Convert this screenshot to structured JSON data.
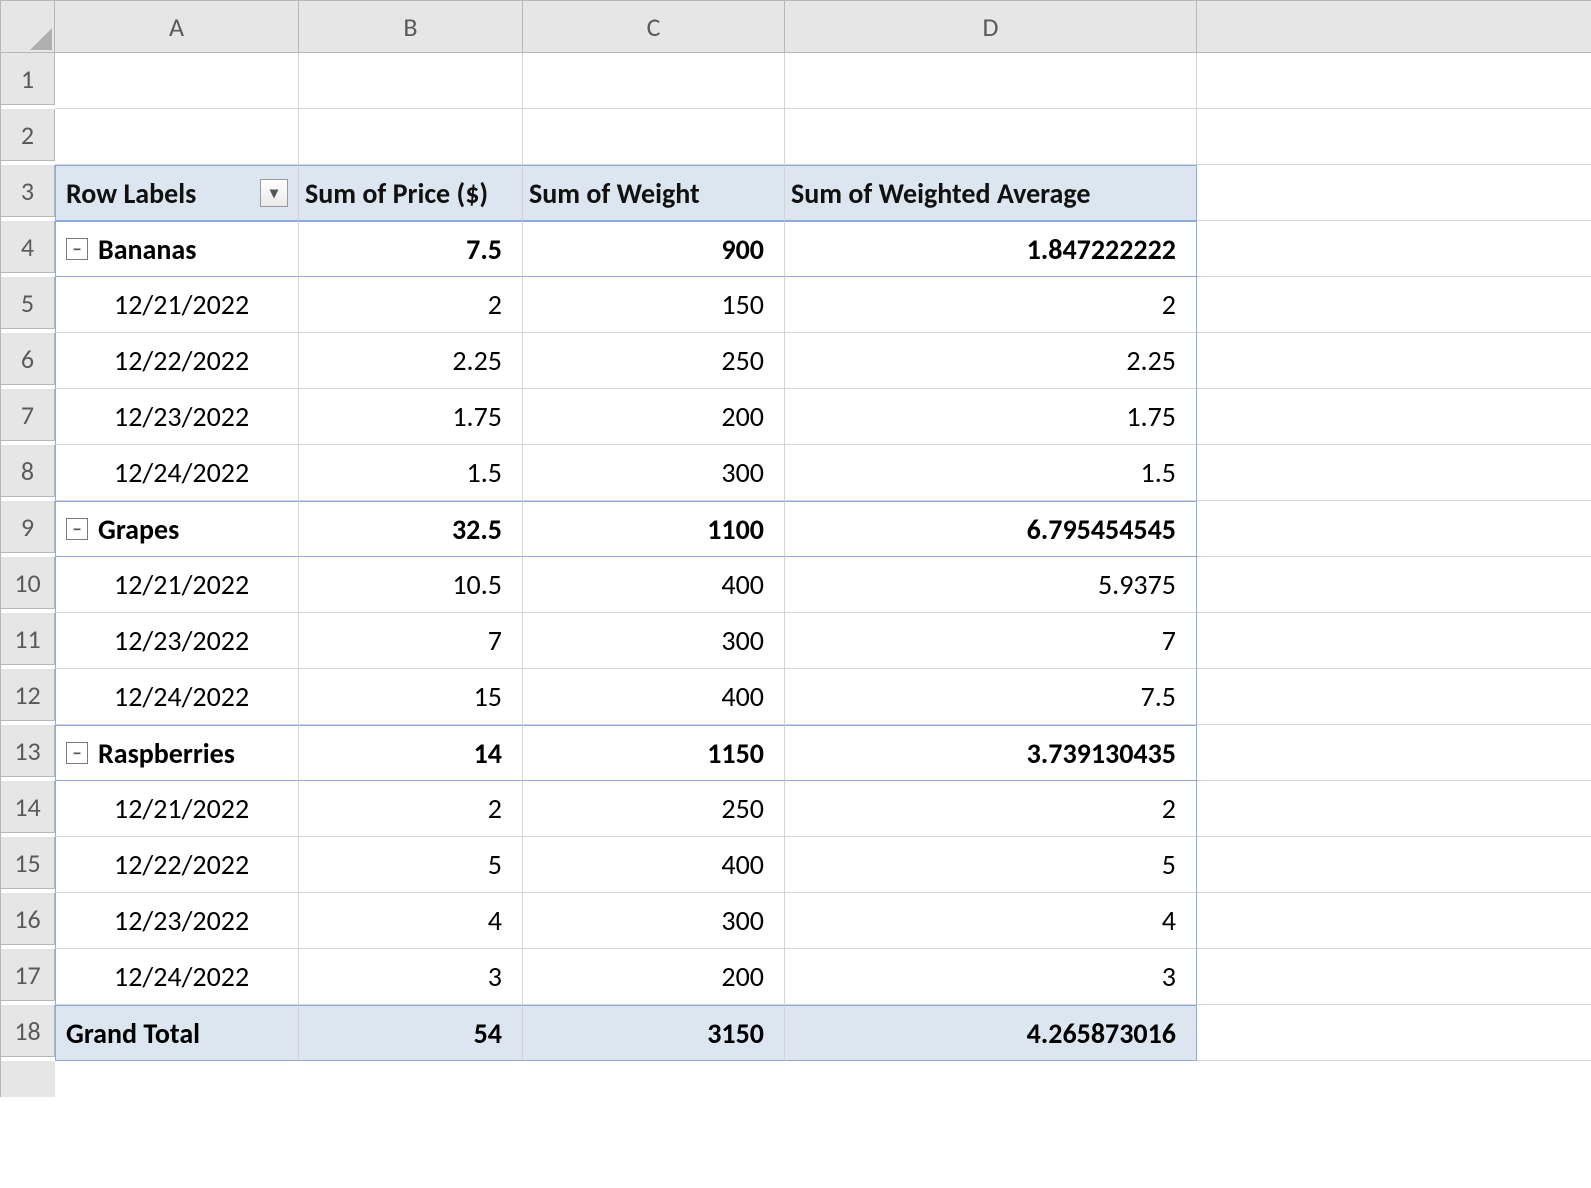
{
  "columns": [
    "A",
    "B",
    "C",
    "D"
  ],
  "rows": [
    "1",
    "2",
    "3",
    "4",
    "5",
    "6",
    "7",
    "8",
    "9",
    "10",
    "11",
    "12",
    "13",
    "14",
    "15",
    "16",
    "17",
    "18"
  ],
  "pivot": {
    "headers": {
      "row_labels": "Row Labels",
      "price": "Sum of Price ($)",
      "weight": "Sum of Weight",
      "weighted": "Sum of Weighted Average"
    },
    "groups": [
      {
        "name": "Bananas",
        "price": "7.5",
        "weight": "900",
        "weighted": "1.847222222",
        "rows": [
          {
            "label": "12/21/2022",
            "price": "2",
            "weight": "150",
            "weighted": "2"
          },
          {
            "label": "12/22/2022",
            "price": "2.25",
            "weight": "250",
            "weighted": "2.25"
          },
          {
            "label": "12/23/2022",
            "price": "1.75",
            "weight": "200",
            "weighted": "1.75"
          },
          {
            "label": "12/24/2022",
            "price": "1.5",
            "weight": "300",
            "weighted": "1.5"
          }
        ]
      },
      {
        "name": "Grapes",
        "price": "32.5",
        "weight": "1100",
        "weighted": "6.795454545",
        "rows": [
          {
            "label": "12/21/2022",
            "price": "10.5",
            "weight": "400",
            "weighted": "5.9375"
          },
          {
            "label": "12/23/2022",
            "price": "7",
            "weight": "300",
            "weighted": "7"
          },
          {
            "label": "12/24/2022",
            "price": "15",
            "weight": "400",
            "weighted": "7.5"
          }
        ]
      },
      {
        "name": "Raspberries",
        "price": "14",
        "weight": "1150",
        "weighted": "3.739130435",
        "rows": [
          {
            "label": "12/21/2022",
            "price": "2",
            "weight": "250",
            "weighted": "2"
          },
          {
            "label": "12/22/2022",
            "price": "5",
            "weight": "400",
            "weighted": "5"
          },
          {
            "label": "12/23/2022",
            "price": "4",
            "weight": "300",
            "weighted": "4"
          },
          {
            "label": "12/24/2022",
            "price": "3",
            "weight": "200",
            "weighted": "3"
          }
        ]
      }
    ],
    "grand": {
      "label": "Grand Total",
      "price": "54",
      "weight": "3150",
      "weighted": "4.265873016"
    }
  }
}
